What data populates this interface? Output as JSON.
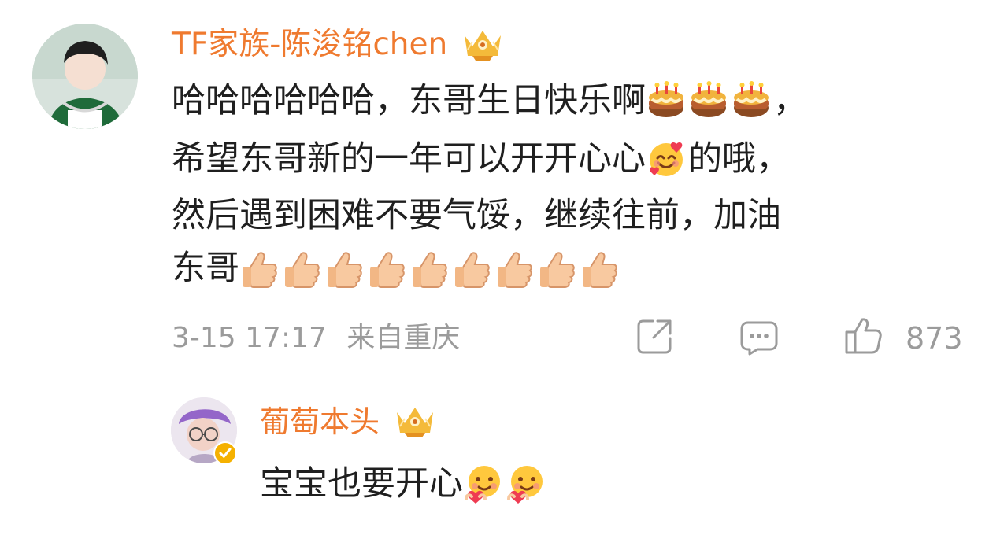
{
  "comment": {
    "username": "TF家族-陈浚铭chen",
    "badge_icon": "crown-badge-icon",
    "lines": [
      {
        "text_a": "哈哈哈哈哈哈，东哥生日快乐啊",
        "emoji": "birthday-cake-icon",
        "emoji_count": 3,
        "text_b": "，"
      },
      {
        "text_a": "希望东哥新的一年可以开开心心",
        "emoji": "smiling-face-with-hearts-icon",
        "emoji_count": 1,
        "text_b": "的哦，"
      },
      {
        "text_a": "然后遇到困难不要气馁，继续往前，加油"
      },
      {
        "text_a": "东哥",
        "emoji": "thumbs-up-icon",
        "emoji_count": 9
      }
    ],
    "date": "3-15 17:17",
    "location": "来自重庆",
    "likes": "873"
  },
  "reply": {
    "username": "葡萄本头",
    "badge_icon": "crown-badge-icon",
    "verified_icon": "verified-badge-icon",
    "text": "宝宝也要开心",
    "emoji": "heart-hug-face-icon",
    "emoji_count": 2
  },
  "colors": {
    "username": "#ef7a2f",
    "meta": "#9b9b9b",
    "text": "#1f1f1f"
  }
}
